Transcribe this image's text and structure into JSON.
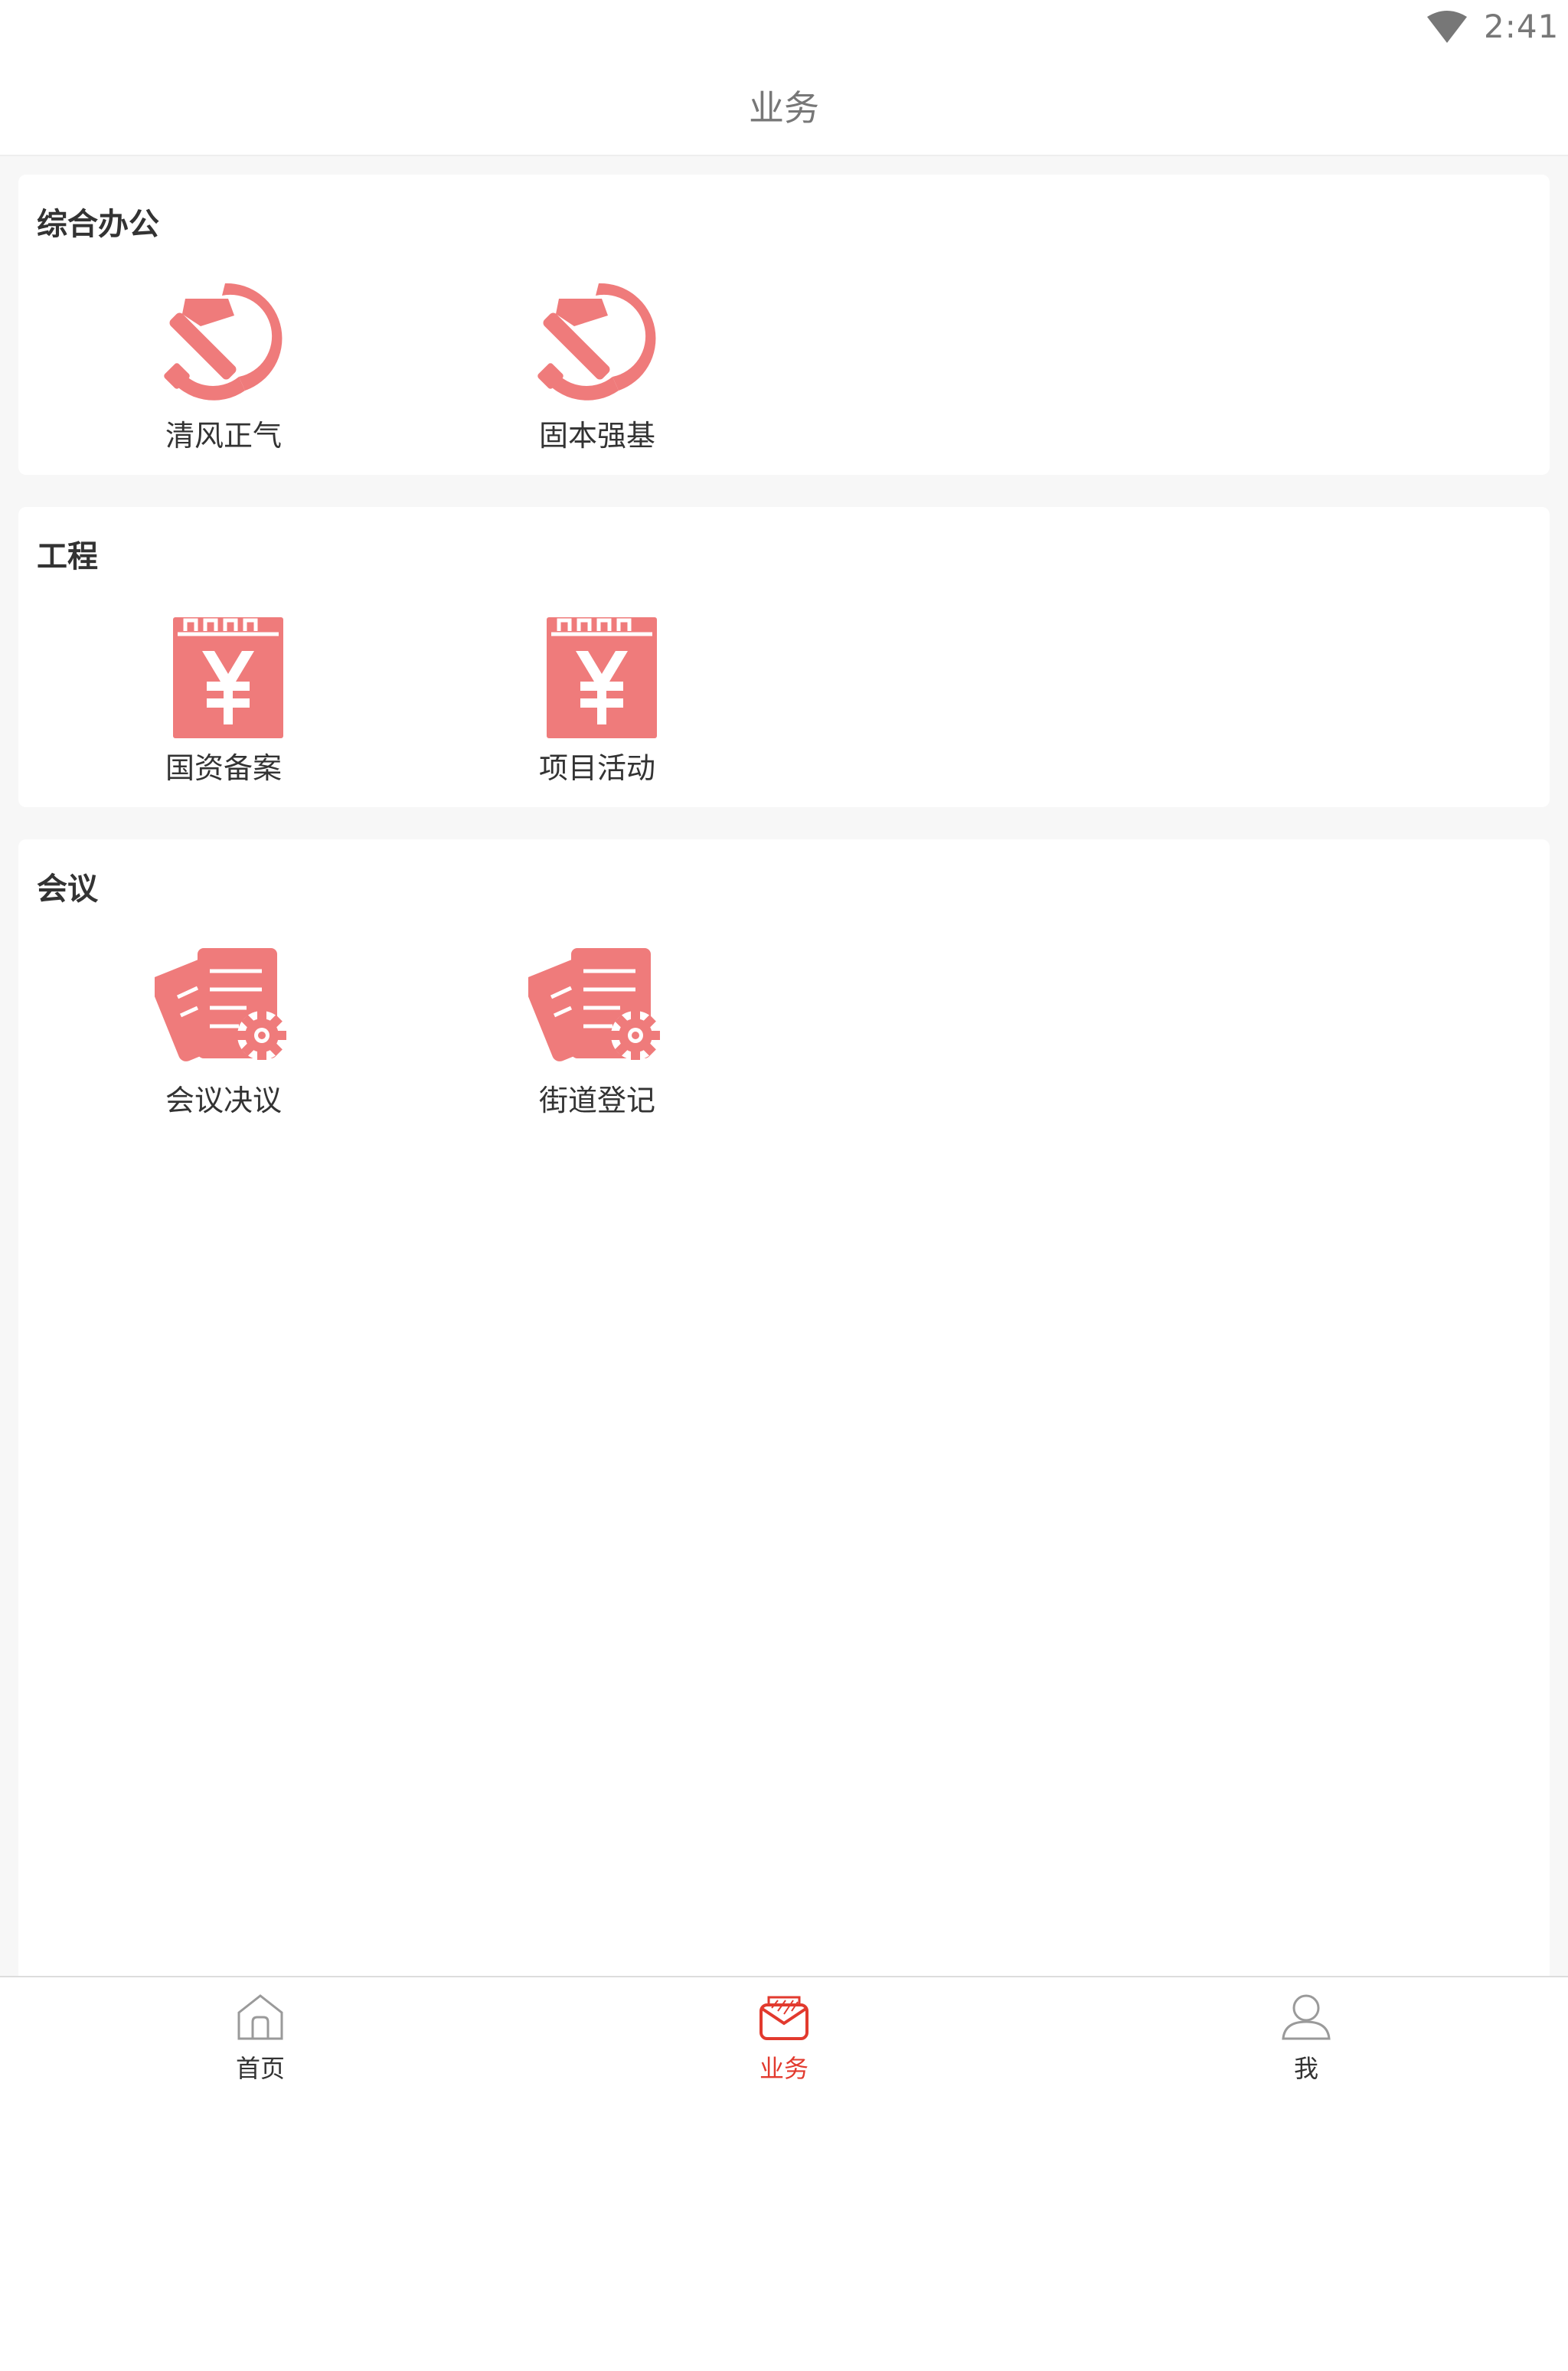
{
  "status_bar": {
    "time": "2:41",
    "wifi_icon": "wifi-icon"
  },
  "header": {
    "title": "业务"
  },
  "sections": [
    {
      "title": "综合办公",
      "items": [
        {
          "label": "清风正气",
          "icon": "hammer-sickle-icon"
        },
        {
          "label": "固本强基",
          "icon": "hammer-sickle-icon"
        }
      ]
    },
    {
      "title": "工程",
      "items": [
        {
          "label": "国资备案",
          "icon": "yen-ledger-icon"
        },
        {
          "label": "项目活动",
          "icon": "yen-ledger-icon"
        }
      ]
    },
    {
      "title": "会议",
      "items": [
        {
          "label": "会议决议",
          "icon": "documents-gear-icon"
        },
        {
          "label": "街道登记",
          "icon": "documents-gear-icon"
        }
      ]
    }
  ],
  "tab_bar": {
    "tabs": [
      {
        "label": "首页",
        "icon": "home-icon",
        "active": false
      },
      {
        "label": "业务",
        "icon": "envelope-icon",
        "active": true
      },
      {
        "label": "我",
        "icon": "user-icon",
        "active": false
      }
    ]
  },
  "colors": {
    "accent": "#e23a2e",
    "icon_fill": "#ef7b7b",
    "title_gray": "#777777"
  }
}
